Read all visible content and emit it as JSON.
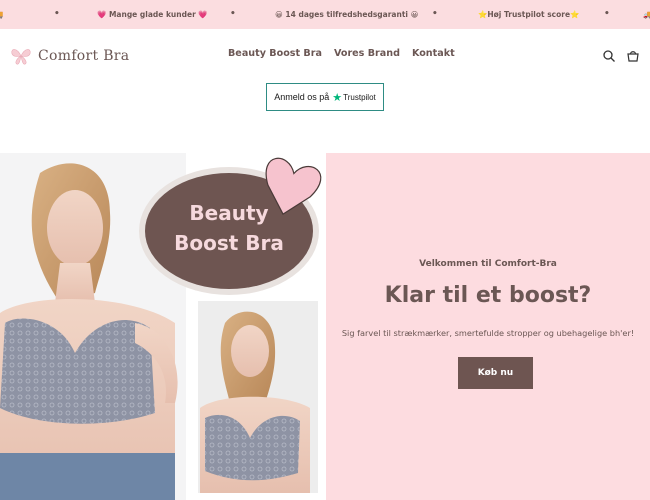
{
  "announcement": {
    "items": [
      "💗 Mange glade kunder 💗",
      "😀 14 dages tilfredshedsgaranti 😀",
      "⭐Høj Trustpilot score⭐"
    ]
  },
  "header": {
    "logo_text": "Comfort Bra",
    "nav": [
      "Beauty Boost Bra",
      "Vores Brand",
      "Kontakt"
    ]
  },
  "trustpilot": {
    "prefix": "Anmeld os på",
    "brand": "Trustpilot"
  },
  "hero": {
    "banner_line1": "Beauty",
    "banner_line2": "Boost Bra",
    "welcome": "Velkommen til Comfort-Bra",
    "headline": "Klar til et boost?",
    "subtext": "Sig farvel til strækmærker, smertefulde stropper og ubehagelige bh'er!",
    "cta": "Køb nu"
  },
  "colors": {
    "pink": "#fbdde0",
    "brown": "#6e5551",
    "text": "#6b5754",
    "trustpilot_green": "#00b67a"
  }
}
